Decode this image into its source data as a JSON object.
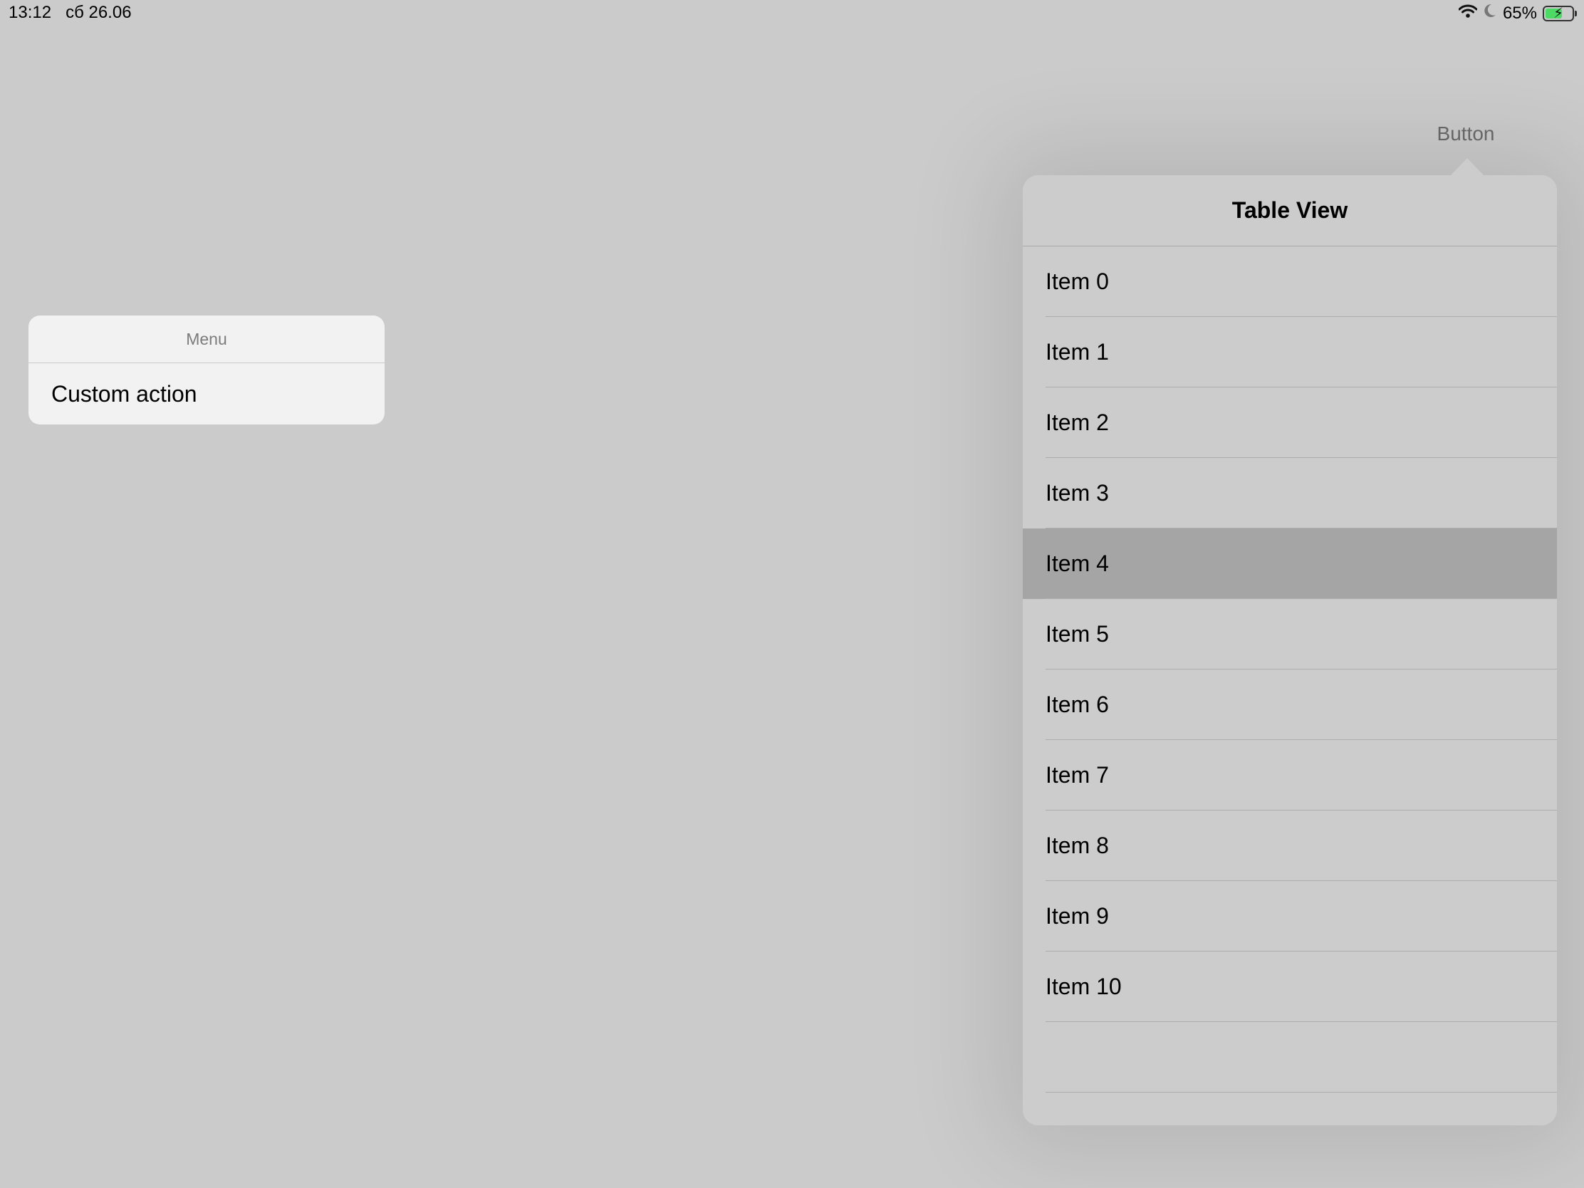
{
  "status_bar": {
    "time": "13:12",
    "date": "сб 26.06",
    "battery_percent": "65%",
    "battery_level": 0.65,
    "icons": [
      "wifi-icon",
      "moon-icon",
      "battery-charging-icon"
    ]
  },
  "top_button": {
    "label": "Button"
  },
  "menu": {
    "title": "Menu",
    "items": [
      {
        "label": "Custom action"
      }
    ]
  },
  "popover": {
    "title": "Table View",
    "items": [
      "Item 0",
      "Item 1",
      "Item 2",
      "Item 3",
      "Item 4",
      "Item 5",
      "Item 6",
      "Item 7",
      "Item 8",
      "Item 9",
      "Item 10",
      ""
    ],
    "selected_index": 4
  },
  "colors": {
    "background": "#cbcbcb",
    "menu_background": "#f2f2f2",
    "popover_background": "#cccccc",
    "selected_row": "#a5a5a6",
    "battery_fill": "#4cd964"
  }
}
